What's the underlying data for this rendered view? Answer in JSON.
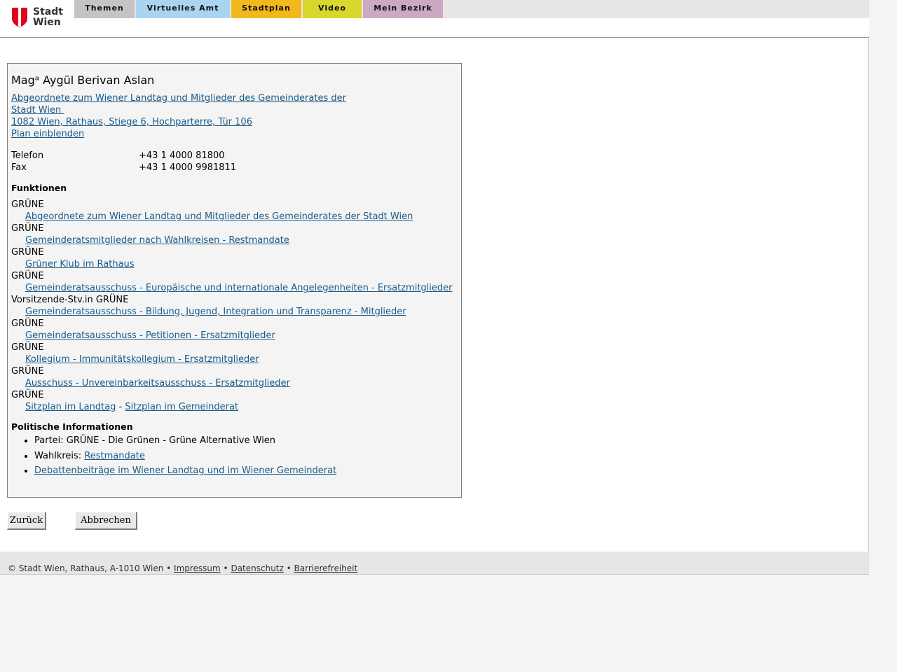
{
  "brand": {
    "line1": "Stadt",
    "line2": "Wien",
    "accent": "#e2001a"
  },
  "nav": {
    "tabs": [
      {
        "label": "Themen",
        "color": "#c4c4c4"
      },
      {
        "label": "Virtuelles Amt",
        "color": "#a9d5f0"
      },
      {
        "label": "Stadtplan",
        "color": "#f2b81c"
      },
      {
        "label": "Video",
        "color": "#d7d72e"
      },
      {
        "label": "Mein Bezirk",
        "color": "#cba8c4"
      }
    ]
  },
  "person": {
    "name": "Magᵃ Aygül Berivan Aslan",
    "position_line1": "Abgeordnete zum Wiener Landtag und Mitglieder des Gemeinderates der",
    "position_line2": "Stadt Wien ",
    "address": "1082 Wien, Rathaus, Stiege 6, Hochparterre, Tür 106",
    "map_link": "Plan einblenden"
  },
  "contact": {
    "phone_label": "Telefon",
    "phone_value": "+43 1 4000 81800",
    "fax_label": "Fax",
    "fax_value": "+43 1 4000 9981811"
  },
  "functions": {
    "title": "Funktionen",
    "items": [
      {
        "role": "GRÜNE",
        "org": "Abgeordnete zum Wiener Landtag und Mitglieder des Gemeinderates der Stadt Wien"
      },
      {
        "role": "GRÜNE",
        "org": "Gemeinderatsmitglieder nach Wahlkreisen - Restmandate"
      },
      {
        "role": "GRÜNE",
        "org": "Grüner Klub im Rathaus"
      },
      {
        "role": "GRÜNE",
        "org": "Gemeinderatsausschuss - Europäische und internationale Angelegenheiten - Ersatzmitglieder"
      },
      {
        "role": "Vorsitzende-Stv.in GRÜNE",
        "org": "Gemeinderatsausschuss - Bildung, Jugend, Integration und Transparenz - Mitglieder"
      },
      {
        "role": "GRÜNE",
        "org": "Gemeinderatsausschuss - Petitionen - Ersatzmitglieder"
      },
      {
        "role": "GRÜNE",
        "org": "Kollegium - Immunitätskollegium - Ersatzmitglieder"
      },
      {
        "role": "GRÜNE",
        "org": "Ausschuss - Unvereinbarkeitsausschuss - Ersatzmitglieder"
      }
    ],
    "last_role": "GRÜNE",
    "seat_link_1": "Sitzplan im Landtag",
    "seat_sep": " - ",
    "seat_link_2": "Sitzplan im Gemeinderat"
  },
  "political": {
    "title": "Politische Informationen",
    "party": "Partei: GRÜNE - Die Grünen - Grüne Alternative Wien",
    "district_label": "Wahlkreis: ",
    "district_link": "Restmandate",
    "debates_link": "Debattenbeiträge im Wiener Landtag und im Wiener Gemeinderat"
  },
  "buttons": {
    "back": "Zurück",
    "cancel": "Abbrechen"
  },
  "footer": {
    "copyright": "© Stadt Wien, Rathaus, A-1010 Wien",
    "sep": " • ",
    "impressum": "Impressum",
    "datenschutz": "Datenschutz",
    "barrierefreiheit": "Barrierefreiheit"
  }
}
